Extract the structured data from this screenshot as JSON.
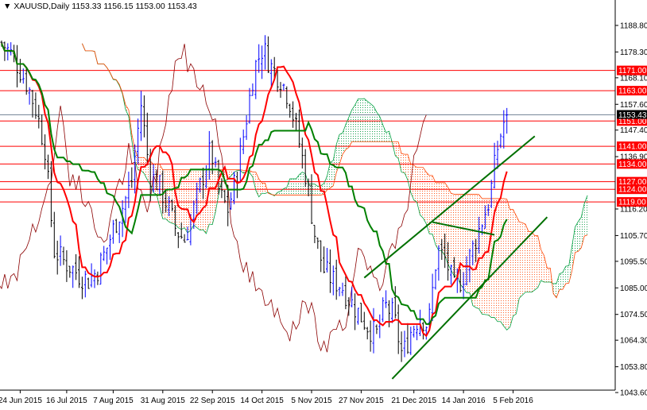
{
  "chart_data": {
    "type": "candlestick",
    "symbol": "XAUUSD,Daily",
    "ohlc_label": {
      "open": "1153.33",
      "high": "1156.15",
      "low": "1153.00",
      "close": "1153.43"
    },
    "current_price": "1153.43",
    "ylim": [
      1041,
      1197
    ],
    "y_ticks": [
      "1188.80",
      "1178.30",
      "1168.10",
      "1157.60",
      "1147.40",
      "1136.90",
      "1116.20",
      "1105.70",
      "1095.50",
      "1085.00",
      "1074.50",
      "1064.30",
      "1053.80",
      "1043.60"
    ],
    "x_ticks": [
      {
        "label": "24 Jun 2015",
        "bar": 6
      },
      {
        "label": "16 Jul 2015",
        "bar": 21
      },
      {
        "label": "7 Aug 2015",
        "bar": 36
      },
      {
        "label": "31 Aug 2015",
        "bar": 52
      },
      {
        "label": "22 Sep 2015",
        "bar": 68
      },
      {
        "label": "14 Oct 2015",
        "bar": 84
      },
      {
        "label": "5 Nov 2015",
        "bar": 100
      },
      {
        "label": "27 Nov 2015",
        "bar": 116
      },
      {
        "label": "21 Dec 2015",
        "bar": 133
      },
      {
        "label": "14 Jan 2016",
        "bar": 149
      },
      {
        "label": "5 Feb 2016",
        "bar": 165
      }
    ],
    "levels": [
      "1171.00",
      "1163.00",
      "1151.00",
      "1141.00",
      "1134.00",
      "1127.00",
      "1124.00",
      "1119.00"
    ],
    "close_path": [
      1182,
      1178,
      1172,
      1165,
      1155,
      1140,
      1100,
      1096,
      1093,
      1090,
      1088,
      1092,
      1100,
      1110,
      1118,
      1128,
      1158,
      1130,
      1126,
      1118,
      1108,
      1104,
      1115,
      1128,
      1140,
      1122,
      1116,
      1130,
      1150,
      1172,
      1180,
      1172,
      1168,
      1160,
      1145,
      1128,
      1105,
      1092,
      1088,
      1086,
      1080,
      1075,
      1070,
      1066,
      1078,
      1074,
      1058,
      1068,
      1074,
      1070,
      1100,
      1096,
      1084,
      1090,
      1100,
      1110,
      1120,
      1142,
      1155
    ],
    "trendlines": [
      {
        "from": [
          117,
          1089
        ],
        "to": [
          172,
          1145
        ]
      },
      {
        "from": [
          126,
          1049
        ],
        "to": [
          176,
          1113
        ]
      },
      {
        "from": [
          139,
          1111
        ],
        "to": [
          159,
          1106
        ]
      }
    ],
    "colors": {
      "bull": "#0000ff",
      "bear": "#000000",
      "tenkan": "#ff0000",
      "kijun": "#008000",
      "chikou": "#8b0000",
      "level": "#ff0000",
      "cloud_up": "#ff4500",
      "cloud_down": "#00a040"
    }
  }
}
